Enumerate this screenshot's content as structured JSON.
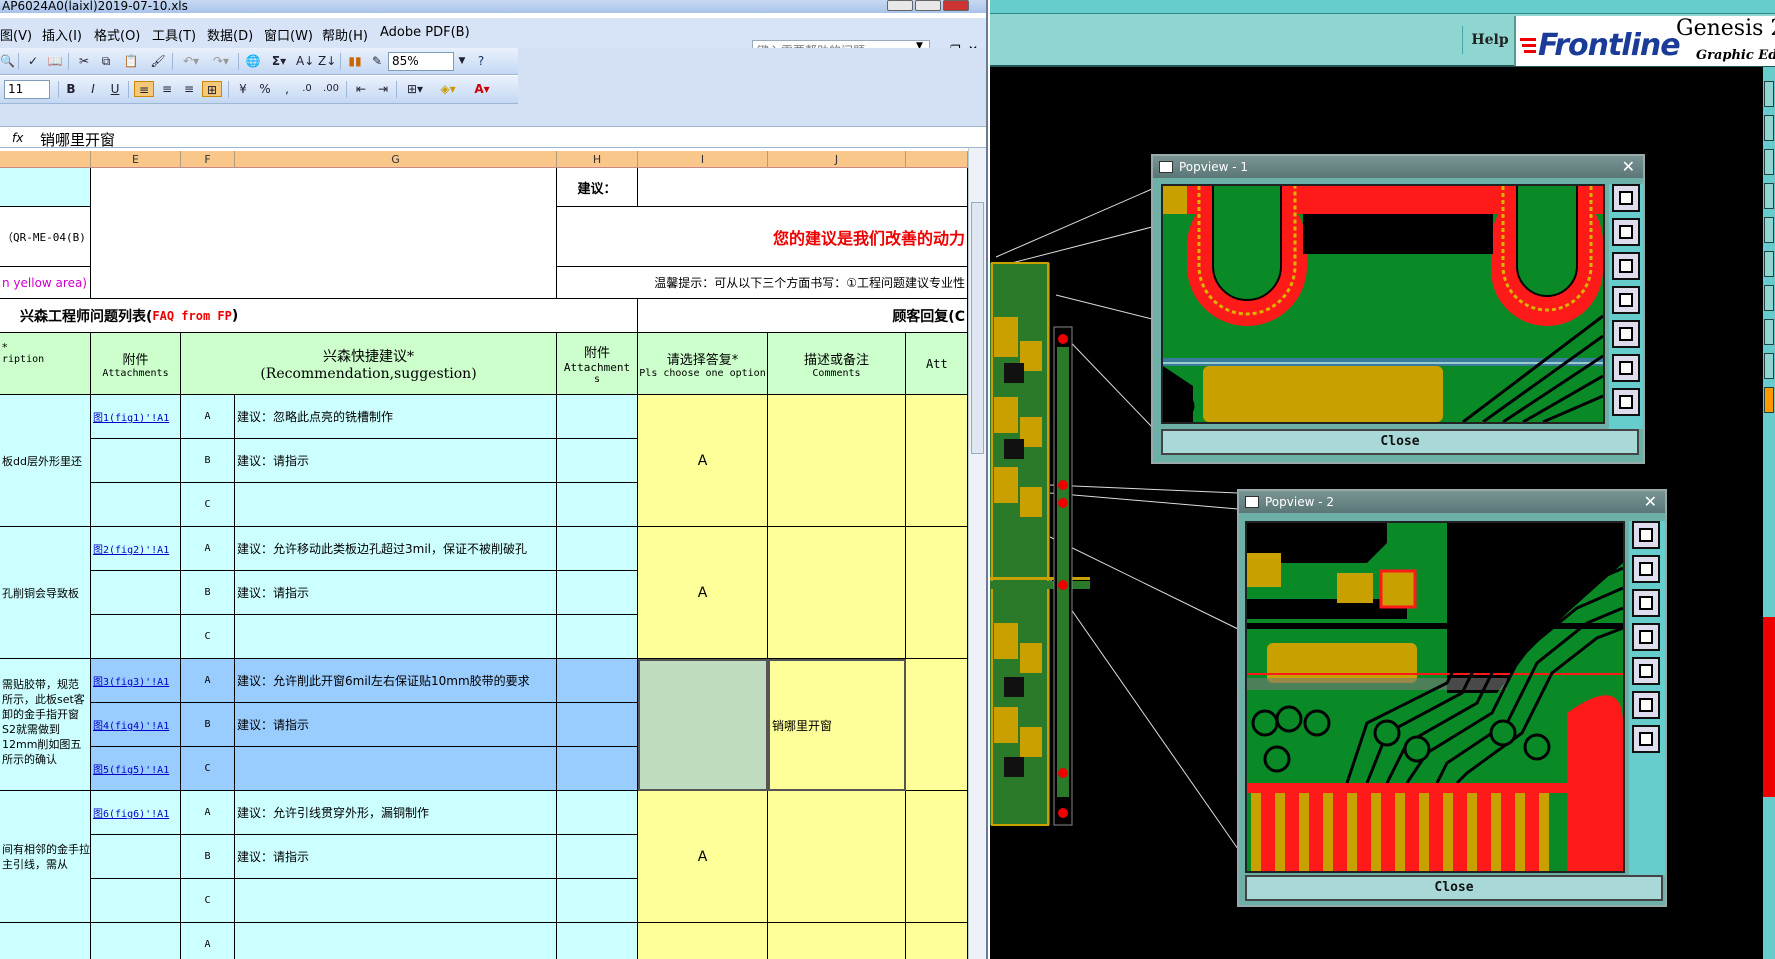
{
  "excel": {
    "title": "AP6024A0(laixl)2019-07-10.xls",
    "menu": [
      "图(V)",
      "插入(I)",
      "格式(O)",
      "工具(T)",
      "数据(D)",
      "窗口(W)",
      "帮助(H)",
      "Adobe PDF(B)"
    ],
    "help_placeholder": "键入需要帮助的问题",
    "zoom": "85%",
    "font_size": "11",
    "formula_value": "销哪里开窗",
    "columns": [
      "E",
      "F",
      "G",
      "H",
      "I",
      "J"
    ],
    "header": {
      "suggest_label": "建议：",
      "motto": "您的建议是我们改善的动力",
      "qr_code": "（QR-ME-04(B)",
      "yellow_area": "n yellow area)",
      "tip": "温馨提示：可从以下三个方面书写：①工程问题建议专业性",
      "list_title_cn": "兴森工程师问题列表(",
      "list_title_en": "FAQ from FP",
      "list_title_end": ")",
      "customer_reply": "顾客回复(C",
      "desc_star": "*",
      "desc_en": "ription",
      "attach_cn": "附件",
      "attach_en": "Attachments",
      "rec_cn": "兴森快捷建议*",
      "rec_en": "(Recommendation,suggestion)",
      "attach2_cn": "附件",
      "attach2_en": "Attachment",
      "attach2_s": "s",
      "choose_cn": "请选择答复*",
      "choose_en": "Pls choose one option",
      "comments_cn": "描述或备注",
      "comments_en": "Comments",
      "att_cut": "Att"
    },
    "groups": [
      {
        "desc": "板dd层外形里还",
        "rows": [
          {
            "link": "图1(fig1)'!A1",
            "opt": "A",
            "text": "建议：忽略此点亮的铣槽制作"
          },
          {
            "link": "",
            "opt": "B",
            "text": "建议：请指示"
          },
          {
            "link": "",
            "opt": "C",
            "text": ""
          }
        ],
        "answer": "A",
        "comment": ""
      },
      {
        "desc": "孔削铜会导致板",
        "rows": [
          {
            "link": "图2(fig2)'!A1",
            "opt": "A",
            "text": "建议：允许移动此类板边孔超过3mil，保证不被削破孔"
          },
          {
            "link": "",
            "opt": "B",
            "text": "建议：请指示"
          },
          {
            "link": "",
            "opt": "C",
            "text": ""
          }
        ],
        "answer": "A",
        "comment": ""
      },
      {
        "desc": "需贴胶带，规范所示，此板set客卸的金手指开窗S2就需做到12mm削如图五所示的确认",
        "rows": [
          {
            "link": "图3(fig3)'!A1",
            "opt": "A",
            "text": "建议：允许削此开窗6mil左右保证贴10mm胶带的要求"
          },
          {
            "link": "图4(fig4)'!A1",
            "opt": "B",
            "text": "建议：请指示"
          },
          {
            "link": "图5(fig5)'!A1",
            "opt": "C",
            "text": ""
          }
        ],
        "answer": "",
        "comment": "销哪里开窗"
      },
      {
        "desc": "间有相邻的金手拉主引线，需从",
        "rows": [
          {
            "link": "图6(fig6)'!A1",
            "opt": "A",
            "text": "建议：允许引线贯穿外形，漏铜制作"
          },
          {
            "link": "",
            "opt": "B",
            "text": "建议：请指示"
          },
          {
            "link": "",
            "opt": "C",
            "text": ""
          }
        ],
        "answer": "A",
        "comment": ""
      }
    ],
    "last_opt": "A"
  },
  "genesis": {
    "help": "Help",
    "logo": "Frontline",
    "product": "Genesis 2",
    "subtitle": "Graphic Ed",
    "popup1": {
      "title": "Popview - 1",
      "close": "Close"
    },
    "popup2": {
      "title": "Popview - 2",
      "close": "Close"
    },
    "close_x": "✕"
  },
  "colors": {
    "pcb_green": "#0a8a26",
    "pad_red": "#ff1a1a",
    "gold": "#c8a000",
    "teal": "#6cc"
  }
}
